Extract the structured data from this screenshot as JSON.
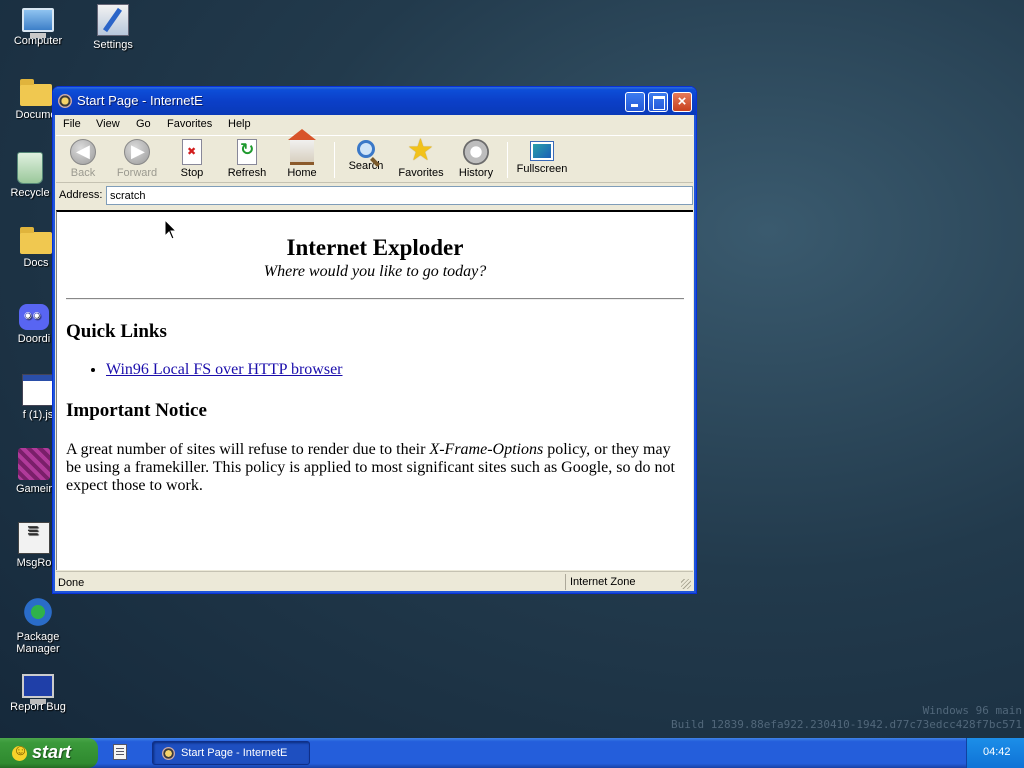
{
  "desktop": {
    "icons": [
      {
        "label": "Computer"
      },
      {
        "label": "Settings"
      },
      {
        "label": "Docume"
      },
      {
        "label": "Recycle"
      },
      {
        "label": "Docs"
      },
      {
        "label": "Doordi"
      },
      {
        "label": "f (1).js"
      },
      {
        "label": "Gameir"
      },
      {
        "label": "MsgRo"
      },
      {
        "label": "Package Manager"
      },
      {
        "label": "Report Bug"
      }
    ]
  },
  "window": {
    "title": "Start Page - InternetE",
    "menu": [
      "File",
      "View",
      "Go",
      "Favorites",
      "Help"
    ],
    "toolbar": {
      "back": "Back",
      "forward": "Forward",
      "stop": "Stop",
      "refresh": "Refresh",
      "home": "Home",
      "search": "Search",
      "favorites": "Favorites",
      "history": "History",
      "fullscreen": "Fullscreen"
    },
    "address": {
      "label": "Address:",
      "value": "scratch"
    },
    "page": {
      "heading": "Internet Exploder",
      "subtitle": "Where would you like to go today?",
      "quick_links_heading": "Quick Links",
      "quick_links": [
        "Win96 Local FS over HTTP browser"
      ],
      "notice_heading": "Important Notice",
      "notice_before": "A great number of sites will refuse to render due to their ",
      "notice_em": "X-Frame-Options",
      "notice_after": " policy, or they may be using a framekiller. This policy is applied to most significant sites such as Google, so do not expect those to work."
    },
    "status": {
      "left": "Done",
      "zone": "Internet Zone"
    }
  },
  "watermark": {
    "line1": "Windows 96 main",
    "line2": "Build 12839.88efa922.230410-1942.d77c73edcc428f7bc571"
  },
  "taskbar": {
    "start_label": "start",
    "task_label": "Start Page - InternetE",
    "clock": "04:42"
  }
}
